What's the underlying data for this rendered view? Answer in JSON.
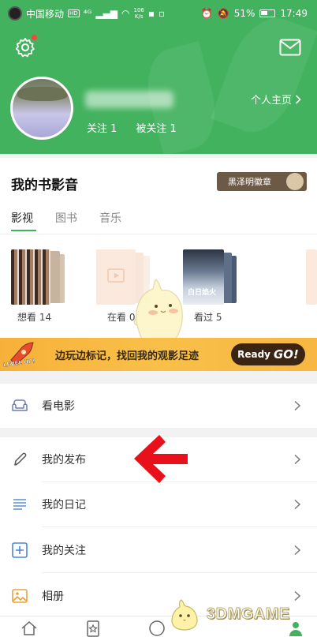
{
  "status_bar": {
    "carrier": "中国移动",
    "hd": "HD",
    "signal": "⁴ᴳ",
    "speed_value": "106",
    "speed_unit": "K/s",
    "battery": "51%",
    "time": "17:49"
  },
  "header": {
    "follow_label": "关注 1",
    "followers_label": "被关注 1",
    "homepage_label": "个人主页"
  },
  "media": {
    "title": "我的书影音",
    "badge": "黑泽明徽章",
    "tabs": [
      "影视",
      "图书",
      "音乐"
    ],
    "want_label": "想看 14",
    "watching_label": "在看 0",
    "watched_label": "看过 5",
    "poster_title": "白日焰火"
  },
  "banner": {
    "rocket_text": "LEVEL UP!",
    "text": "边玩边标记，找回我的观影足迹",
    "button_ready": "Ready",
    "button_go": "GO!"
  },
  "menu": {
    "items": [
      {
        "label": "看电影",
        "icon": "sofa-icon"
      },
      {
        "label": "我的发布",
        "icon": "pencil-icon"
      },
      {
        "label": "我的日记",
        "icon": "lines-icon"
      },
      {
        "label": "我的关注",
        "icon": "plus-box-icon"
      },
      {
        "label": "相册",
        "icon": "image-icon"
      }
    ]
  },
  "watermark": "3DMGAME",
  "colors": {
    "brand_green": "#42b25e",
    "banner_orange": "#f8c049",
    "arrow_red": "#e8101a"
  }
}
